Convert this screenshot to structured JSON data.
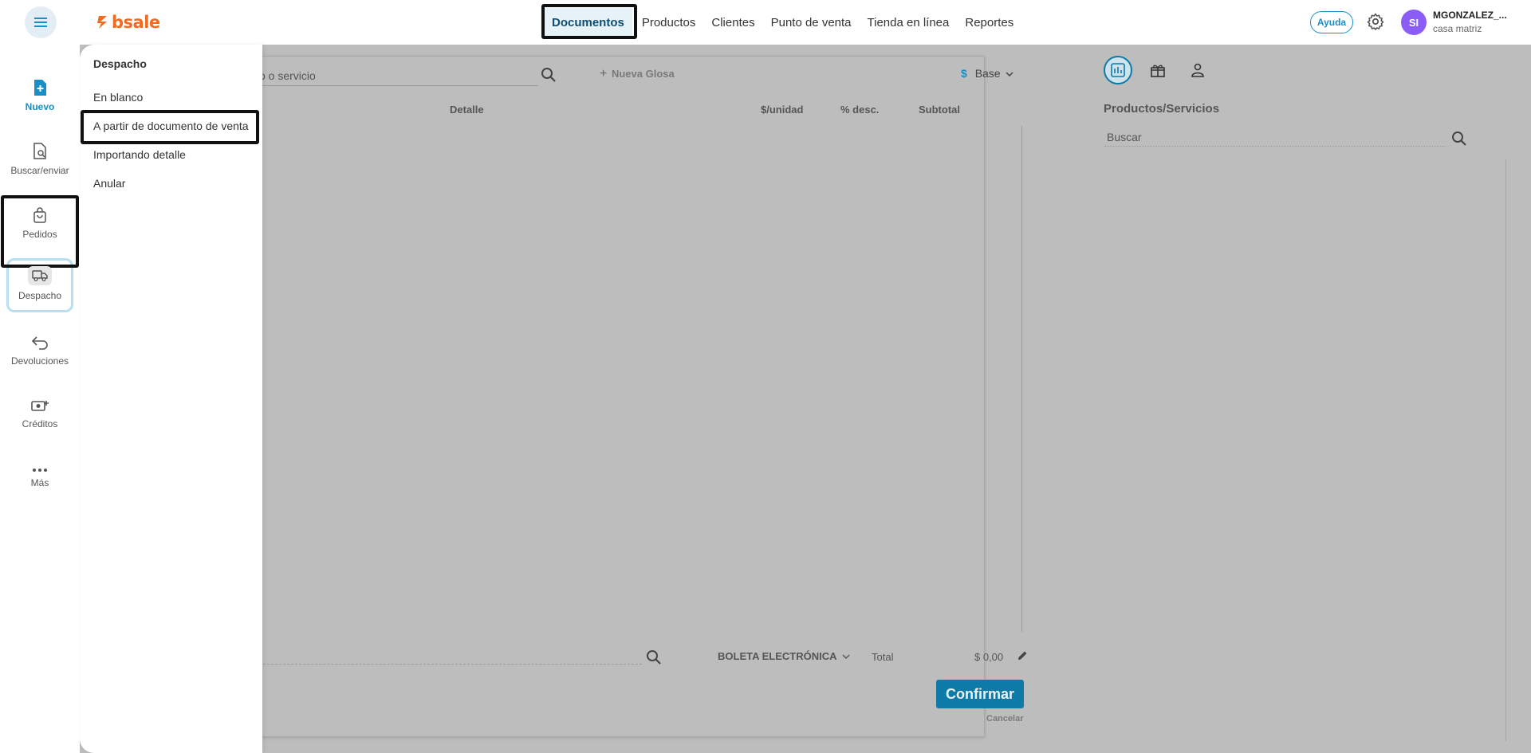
{
  "brand": {
    "name": "bsale",
    "color": "#f26b21"
  },
  "topnav": {
    "items": [
      "Documentos",
      "Productos",
      "Clientes",
      "Punto de venta",
      "Tienda en línea",
      "Reportes"
    ],
    "active": "Documentos"
  },
  "header": {
    "help_label": "Ayuda",
    "avatar_initials": "SI",
    "user_name": "MGONZALEZ_...",
    "branch": "casa matriz"
  },
  "sidebar": {
    "items": [
      {
        "label": "Nuevo",
        "icon": "file-plus-icon"
      },
      {
        "label": "Buscar/enviar",
        "icon": "file-search-icon"
      },
      {
        "label": "Pedidos",
        "icon": "bag-icon"
      },
      {
        "label": "Despacho",
        "icon": "truck-icon"
      },
      {
        "label": "Devoluciones",
        "icon": "undo-arrow-icon"
      },
      {
        "label": "Créditos",
        "icon": "money-plus-icon"
      },
      {
        "label": "Más",
        "icon": "more-dots-icon"
      }
    ]
  },
  "menu": {
    "title": "Despacho",
    "items": [
      "En blanco",
      "A partir de documento de venta",
      "Importando detalle",
      "Anular"
    ]
  },
  "document": {
    "search_placeholder": "o o servicio",
    "new_gloss": "Nueva Glosa",
    "price_list": "Base",
    "columns": [
      "Detalle",
      "$/unidad",
      "% desc.",
      "Subtotal"
    ],
    "doc_type": "BOLETA ELECTRÓNICA",
    "total_label": "Total",
    "total_value": "$ 0,00",
    "confirm_label": "Confirmar",
    "cancel_label": "Cancelar"
  },
  "right_panel": {
    "title": "Productos/Servicios",
    "search_placeholder": "Buscar"
  },
  "colors": {
    "accent": "#1a8fc6",
    "confirm": "#0e7aa8",
    "overlay": "#bdbdbd",
    "avatar": "#8b5cf6"
  }
}
